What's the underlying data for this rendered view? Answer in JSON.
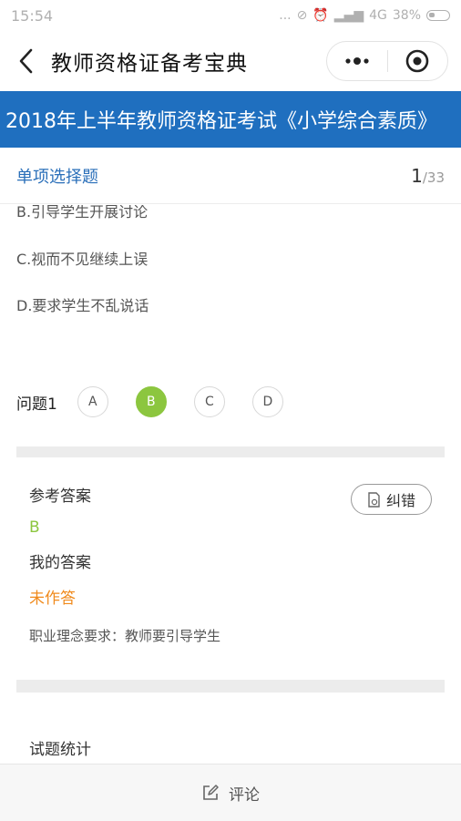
{
  "status_bar": {
    "time": "15:54",
    "signal_text": "...",
    "network": "4G",
    "battery": "38%"
  },
  "nav": {
    "title": "教师资格证备考宝典"
  },
  "banner": {
    "text": "2018年上半年教师资格证考试《小学综合素质》"
  },
  "question_header": {
    "type_label": "单项选择题",
    "current": "1",
    "total": "/33"
  },
  "options": [
    {
      "text": "B.引导学生开展讨论"
    },
    {
      "text": "C.视而不见继续上误"
    },
    {
      "text": "D.要求学生不乱说话"
    }
  ],
  "question_row": {
    "label": "问题1",
    "choices": [
      "A",
      "B",
      "C",
      "D"
    ],
    "selected": "B"
  },
  "answer": {
    "reference_label": "参考答案",
    "reference_value": "B",
    "my_label": "我的答案",
    "my_value": "未作答",
    "note": "职业理念要求：教师要引导学生",
    "correct_button_label": "纠错"
  },
  "next_section": {
    "title": "试题统计"
  },
  "footer": {
    "comment_label": "评论"
  },
  "colors": {
    "banner": "#1f6fbf",
    "selected": "#8cc63f",
    "unanswered": "#f08a1c",
    "type_label": "#2a6fb9"
  }
}
